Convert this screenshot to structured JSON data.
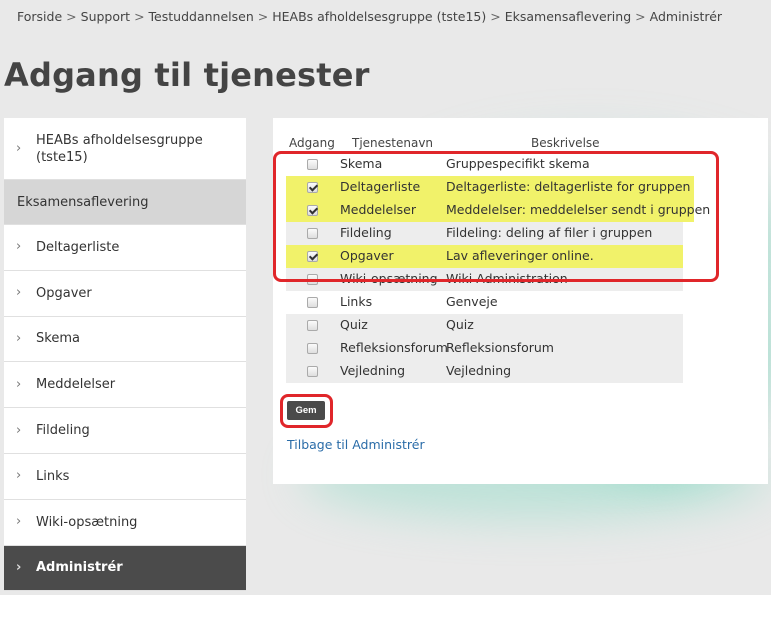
{
  "breadcrumb": [
    "Forside",
    "Support",
    "Testuddannelsen",
    "HEABs afholdelsesgruppe (tste15)",
    "Eksamensaflevering",
    "Administrér"
  ],
  "breadcrumb_separator": ">",
  "page_title": "Adgang til tjenester",
  "sidebar": {
    "top_item": "HEABs afholdelsesgruppe (tste15)",
    "group_label": "Eksamensaflevering",
    "items": [
      "Deltagerliste",
      "Opgaver",
      "Skema",
      "Meddelelser",
      "Fildeling",
      "Links",
      "Wiki-opsætning",
      "Administrér"
    ],
    "active_item": "Administrér",
    "chevron_glyph": "›"
  },
  "table": {
    "headers": {
      "access": "Adgang",
      "name": "Tjenestenavn",
      "description": "Beskrivelse"
    },
    "rows": [
      {
        "name": "Skema",
        "description": "Gruppespecifikt skema",
        "checked": false,
        "highlighted": false
      },
      {
        "name": "Deltagerliste",
        "description": "Deltagerliste: deltagerliste for gruppen",
        "checked": true,
        "highlighted": true
      },
      {
        "name": "Meddelelser",
        "description": "Meddelelser: meddelelser sendt i gruppen",
        "checked": true,
        "highlighted": true
      },
      {
        "name": "Fildeling",
        "description": "Fildeling: deling af filer i gruppen",
        "checked": false,
        "highlighted": false
      },
      {
        "name": "Opgaver",
        "description": "Lav afleveringer online.",
        "checked": true,
        "highlighted": true
      },
      {
        "name": "Wiki-opsætning",
        "description": "Wiki Administration",
        "checked": false,
        "highlighted": false
      },
      {
        "name": "Links",
        "description": "Genveje",
        "checked": false,
        "highlighted": false
      },
      {
        "name": "Quiz",
        "description": "Quiz",
        "checked": false,
        "highlighted": false
      },
      {
        "name": "Refleksionsforum",
        "description": "Refleksionsforum",
        "checked": false,
        "highlighted": false
      },
      {
        "name": "Vejledning",
        "description": "Vejledning",
        "checked": false,
        "highlighted": false
      }
    ]
  },
  "save_button": "Gem",
  "back_link": "Tilbage til Administrér",
  "colors": {
    "highlight": "#f1f26a",
    "annotation_border": "#e0262a",
    "active_sidebar": "#4b4b4b",
    "link": "#2a6ca8",
    "background_wash": "#7dd8bf"
  }
}
